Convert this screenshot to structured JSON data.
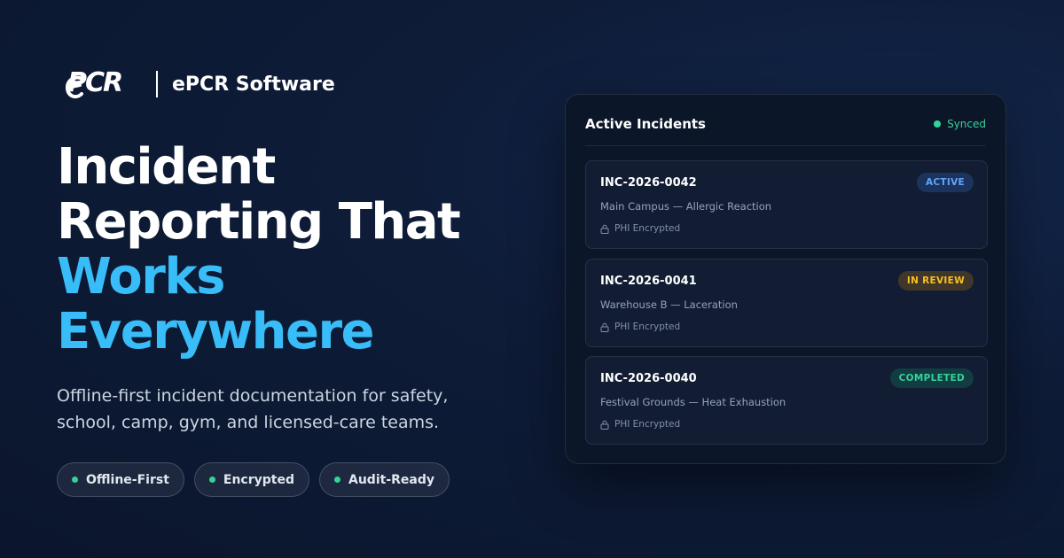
{
  "brand": {
    "logo_text": "PCR",
    "name": "ePCR Software"
  },
  "headline": {
    "line1": "Incident",
    "line2": "Reporting That",
    "line3": "Works",
    "line4": "Everywhere"
  },
  "subtitle": "Offline-first incident documentation for safety, school, camp, gym, and licensed-care teams.",
  "features": [
    {
      "label": "Offline-First"
    },
    {
      "label": "Encrypted"
    },
    {
      "label": "Audit-Ready"
    }
  ],
  "panel": {
    "title": "Active Incidents",
    "sync_status": "Synced",
    "incidents": [
      {
        "id": "INC-2026-0042",
        "description": "Main Campus — Allergic Reaction",
        "security": "PHI Encrypted",
        "status": "ACTIVE",
        "status_color": "#60a5fa"
      },
      {
        "id": "INC-2026-0041",
        "description": "Warehouse B — Laceration",
        "security": "PHI Encrypted",
        "status": "IN REVIEW",
        "status_color": "#fbbf24"
      },
      {
        "id": "INC-2026-0040",
        "description": "Festival Grounds — Heat Exhaustion",
        "security": "PHI Encrypted",
        "status": "COMPLETED",
        "status_color": "#34d399"
      }
    ]
  },
  "colors": {
    "accent": "#38bdf8",
    "success": "#34d399",
    "warning": "#fbbf24",
    "info": "#60a5fa"
  }
}
